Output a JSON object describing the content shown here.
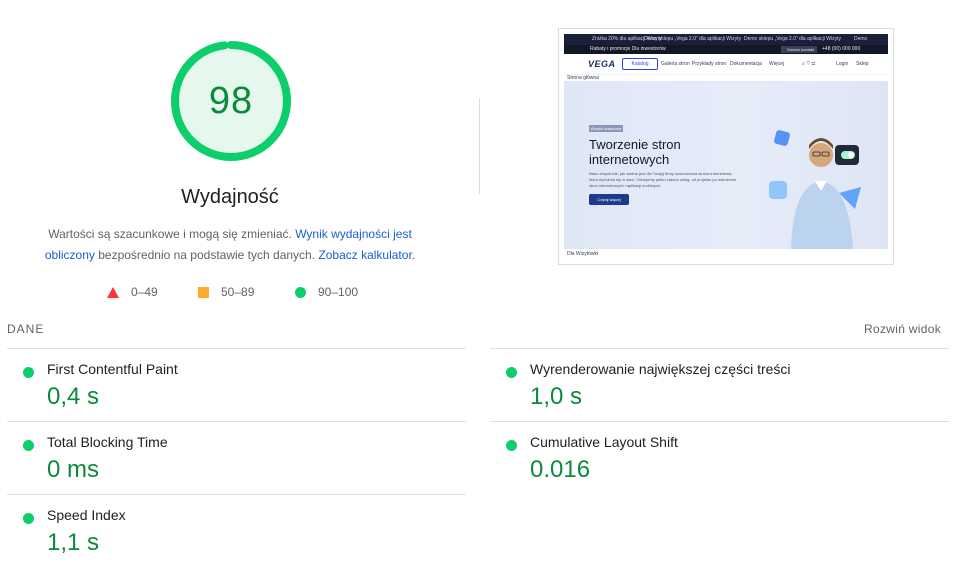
{
  "gauge": {
    "score": "98",
    "score_value": 98,
    "label": "Wydajność",
    "color": "#0cce6b"
  },
  "description": {
    "part1": "Wartości są szacunkowe i mogą się zmieniać. ",
    "link1": "Wynik wydajności jest obliczony",
    "part2": " bezpośrednio na podstawie tych danych. ",
    "link2": "Zobacz kalkulator",
    "part3": "."
  },
  "legend": [
    {
      "icon": "triangle-red-icon",
      "label": "0–49",
      "color": "#ff3333"
    },
    {
      "icon": "square-orange-icon",
      "label": "50–89",
      "color": "#ffaa33"
    },
    {
      "icon": "circle-green-icon",
      "label": "90–100",
      "color": "#0cce6b"
    }
  ],
  "thumbnail": {
    "topbar": [
      "Zniżka 20% dla aplikacji Wizyty",
      "Demo sklepu „Vega 2.0” dla aplikacji Wizyty",
      "Demo sklepu „Vega 2.0” dla aplikacji Wizyty",
      "Demo"
    ],
    "secondbar_left": "Rabaty i promocje   Dla inwestorów",
    "secondbar_phone": "Zamów kontakt",
    "secondbar_phone_number": "+48 (00) 000 000",
    "logo": "VEGA",
    "catalog_button": "Katalog",
    "menu": [
      "Galeria stron",
      "Przykłady stron",
      "Dokumentacja",
      "Więcej"
    ],
    "menu_right": [
      "Login",
      "Sklep"
    ],
    "breadcrumb": "Strona główna",
    "hero_tag": "Wizytki branżowe",
    "hero_title": "Tworzenie stron internetowych",
    "hero_text": "Nasz zespół wie, jak ważna jest dla Twojej firmy nowoczesna strona internetowa, która wyróżnia się w sieci. Oferujemy pełen zakres usług, od projektu po wdrożenie stron internetowych i aplikacji mobilnych.",
    "hero_button": "Czytaj więcej",
    "footer": "Dla Wizytówki"
  },
  "metrics_header": {
    "title": "DANE",
    "expand_label": "Rozwiń widok"
  },
  "metrics": [
    {
      "name": "First Contentful Paint",
      "value": "0,4 s"
    },
    {
      "name": "Wyrenderowanie największej części treści",
      "value": "1,0 s"
    },
    {
      "name": "Total Blocking Time",
      "value": "0 ms"
    },
    {
      "name": "Cumulative Layout Shift",
      "value": "0.016"
    },
    {
      "name": "Speed Index",
      "value": "1,1 s"
    }
  ],
  "colors": {
    "good": "#0cce6b",
    "good_text": "#0a8a3a",
    "link": "#1a5fd1"
  }
}
